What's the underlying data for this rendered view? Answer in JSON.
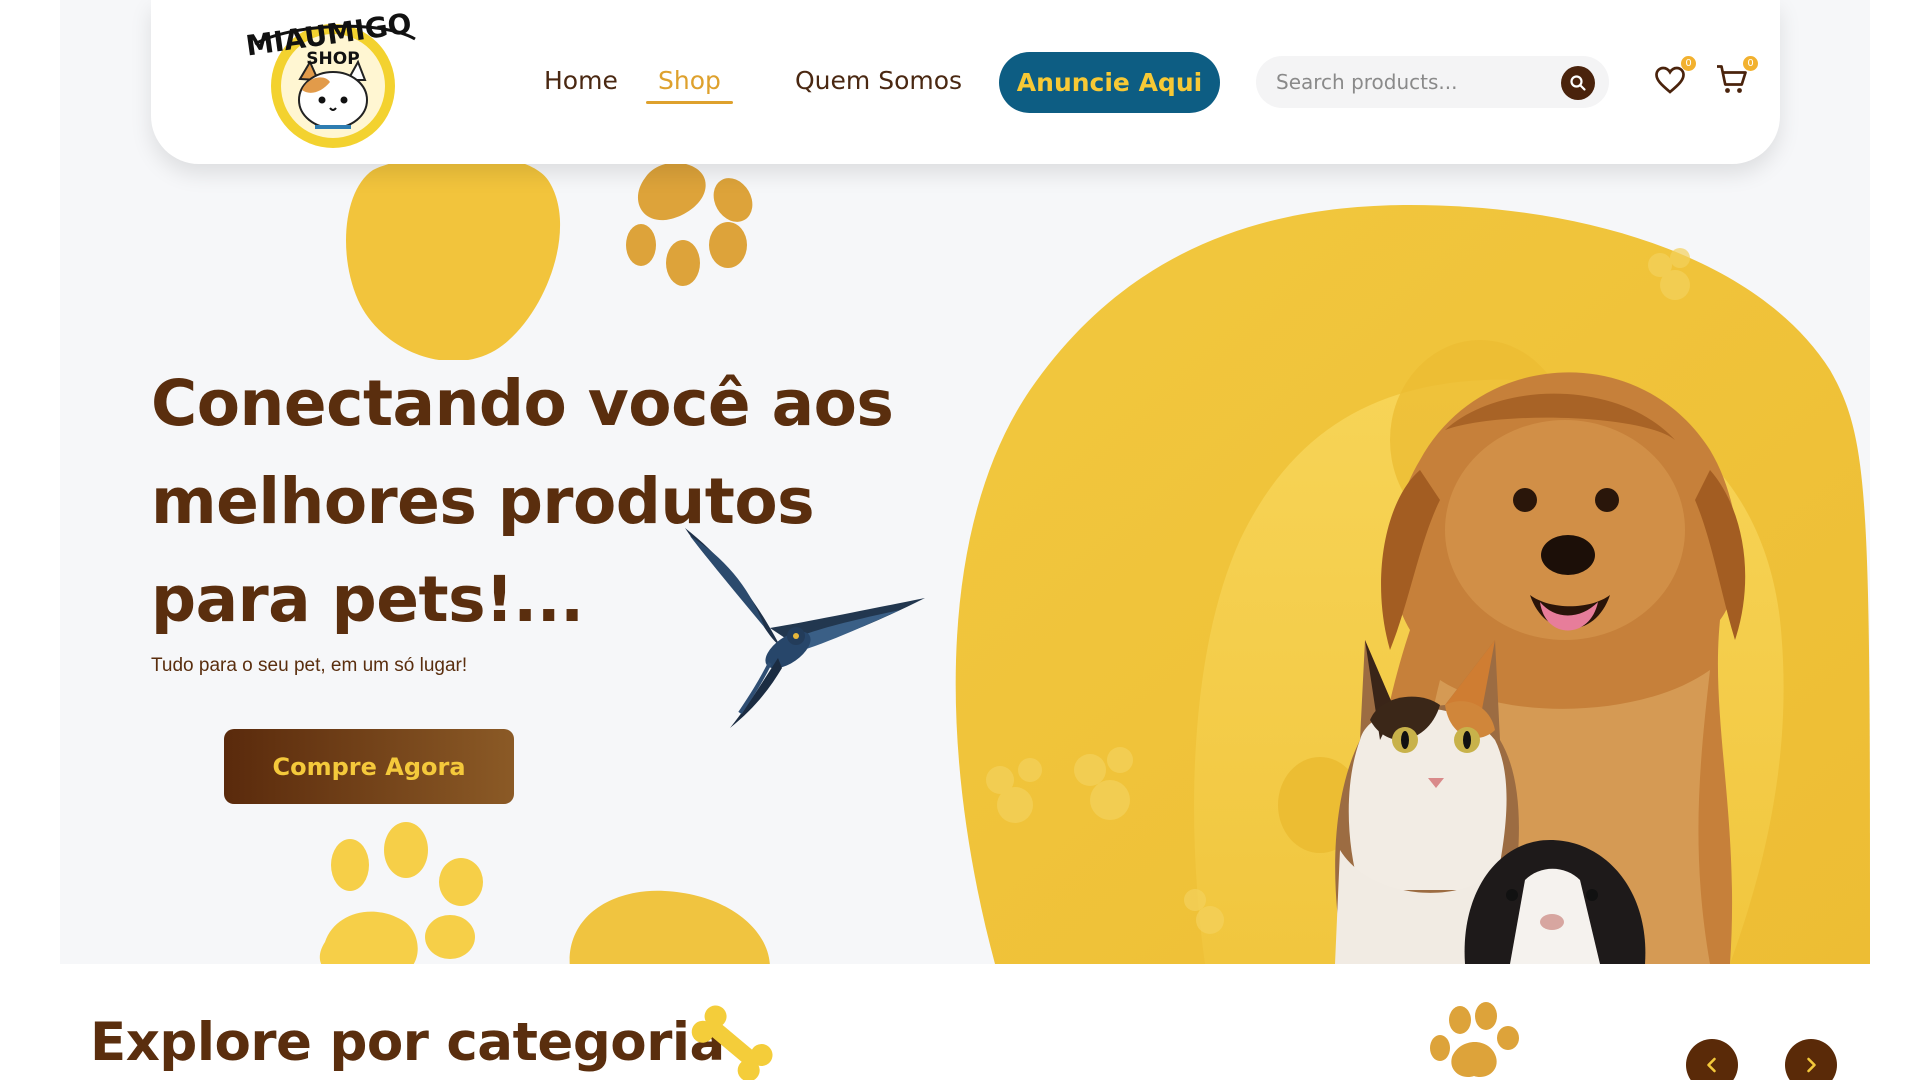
{
  "brand": {
    "logo_text_top": "MIAUMIGO",
    "logo_text_bottom": "SHOP"
  },
  "nav": {
    "items": [
      {
        "label": "Home",
        "active": false
      },
      {
        "label": "Shop",
        "active": true
      },
      {
        "label": "Quem Somos",
        "active": false
      }
    ],
    "advertise_label": "Anuncie Aqui",
    "search_placeholder": "Search products...",
    "wishlist_count": "0",
    "cart_count": "0"
  },
  "hero": {
    "title_lines": [
      "Conectando você aos",
      "melhores produtos",
      "para pets!..."
    ],
    "subtitle": "Tudo para o seu pet, em um só lugar!",
    "cta_label": "Compre Agora"
  },
  "categories": {
    "title": "Explore por categoria"
  },
  "colors": {
    "brand_brown": "#5a2e0e",
    "accent_yellow": "#f4c93b",
    "accent_gold": "#dea12d",
    "advertise_blue": "#0d5d83",
    "hero_background": "#f6f7f9"
  },
  "icons": [
    "search-icon",
    "heart-icon",
    "cart-icon",
    "chevron-left-icon",
    "chevron-right-icon",
    "paw-icon",
    "bone-icon"
  ]
}
